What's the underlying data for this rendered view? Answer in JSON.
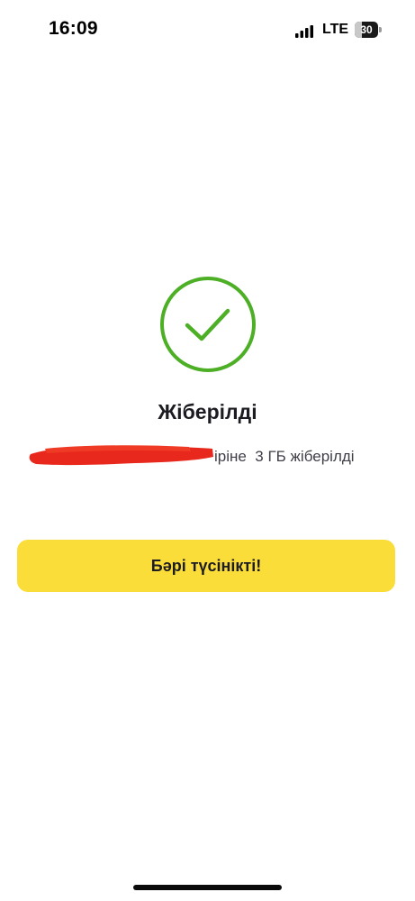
{
  "status_bar": {
    "time": "16:09",
    "network": "LTE",
    "battery_level": "30",
    "battery_fraction": 0.3,
    "icons": [
      "signal-bars-icon",
      "battery-icon"
    ]
  },
  "content": {
    "icon": "check-circle-icon",
    "title": "Жіберілді",
    "message": "іріне  3 ГБ жіберілді"
  },
  "button": {
    "label": "Бәрі түсінікті!"
  },
  "colors": {
    "success_green": "#4caf26",
    "button_yellow": "#fbdd3a",
    "redaction_red": "#e8281c"
  }
}
